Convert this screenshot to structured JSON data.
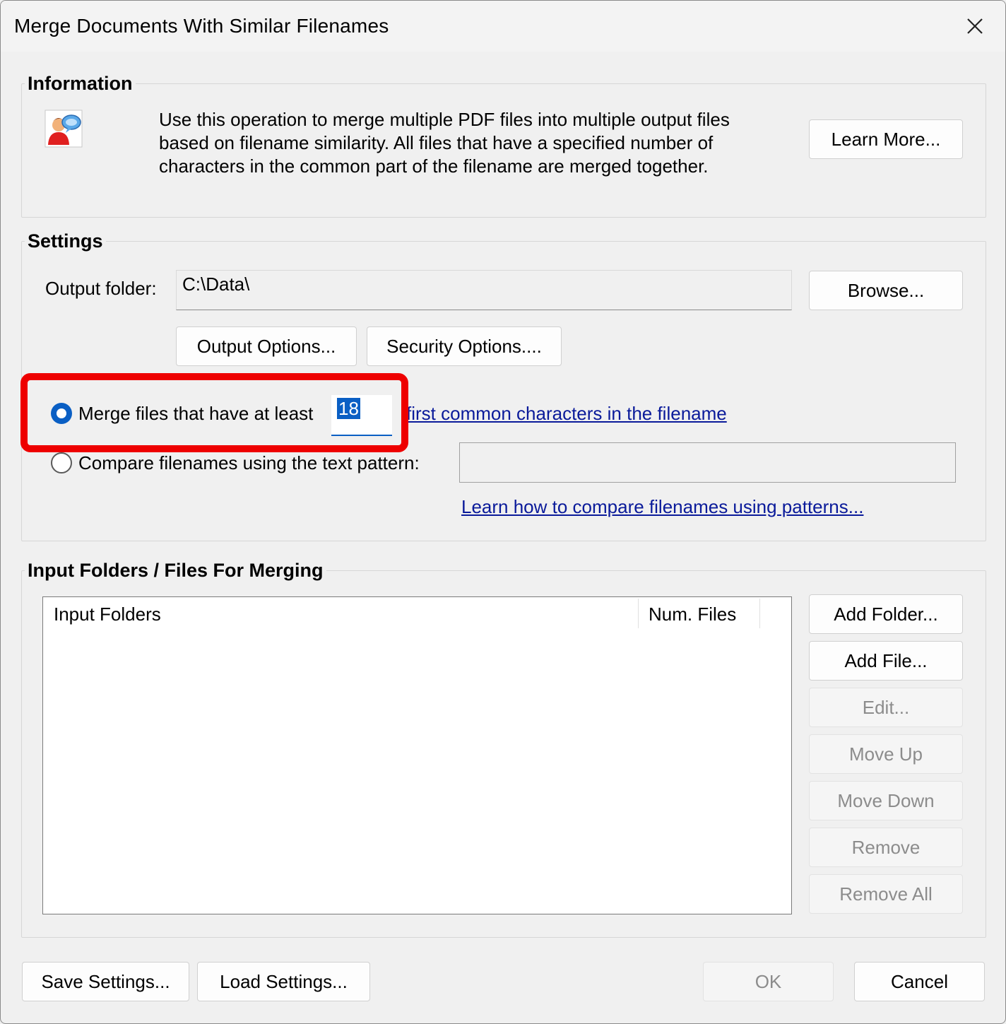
{
  "window": {
    "title": "Merge Documents With Similar Filenames"
  },
  "information": {
    "heading": "Information",
    "description_lines": [
      "Use this operation to merge multiple PDF files into multiple output files",
      "based on filename similarity. All files that have a specified number of",
      "characters in the common part of the filename are merged together."
    ],
    "learn_more_label": "Learn More...",
    "icon": "user-help-icon"
  },
  "settings": {
    "heading": "Settings",
    "output_folder_label": "Output folder:",
    "output_folder_value": "C:\\Data\\",
    "browse_label": "Browse...",
    "output_options_label": "Output Options...",
    "security_options_label": "Security Options....",
    "merge_radio_label": "Merge files that have at least",
    "merge_count_value": "18",
    "merge_suffix_link": "first common characters in the filename",
    "pattern_radio_label": "Compare filenames using the text pattern:",
    "pattern_value": "",
    "pattern_help_link": "Learn how to compare filenames using patterns...",
    "selected_mode": "merge"
  },
  "input": {
    "heading": "Input Folders / Files For Merging",
    "columns": [
      "Input Folders",
      "Num. Files"
    ],
    "rows": [],
    "buttons": {
      "add_folder": "Add Folder...",
      "add_file": "Add File...",
      "edit": "Edit...",
      "move_up": "Move Up",
      "move_down": "Move Down",
      "remove": "Remove",
      "remove_all": "Remove All"
    }
  },
  "footer": {
    "save_settings": "Save Settings...",
    "load_settings": "Load Settings...",
    "ok": "OK",
    "cancel": "Cancel"
  },
  "colors": {
    "highlight": "#ee0000",
    "link": "#0a1a9a",
    "radio_selected": "#0a5fc4",
    "text_selection": "#0a5fc4"
  }
}
